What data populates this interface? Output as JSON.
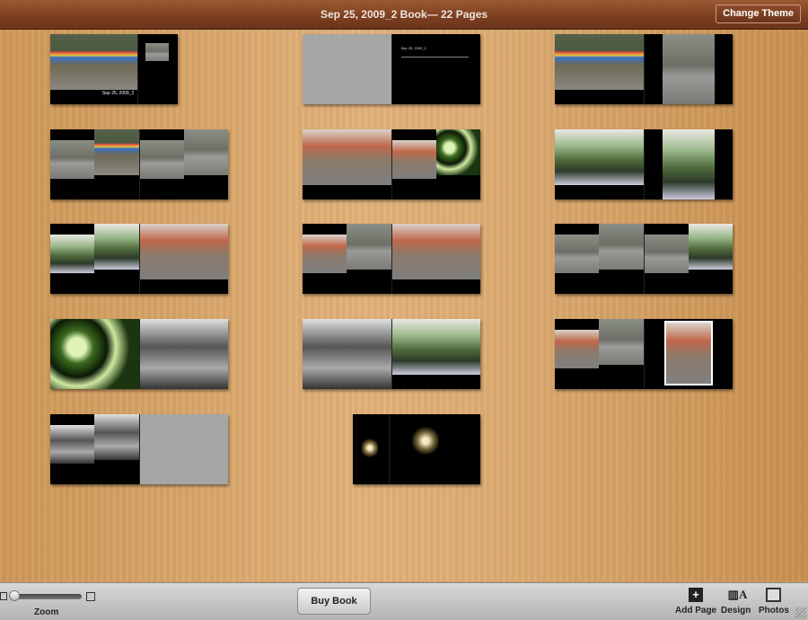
{
  "window": {
    "title": "Sep 25, 2009_2 Book— 22 Pages",
    "change_theme": "Change Theme"
  },
  "cover": {
    "title": "Sep 25, 2009_2"
  },
  "spreads": [
    {
      "row": 0,
      "col": 0,
      "kind": "cover",
      "pages": [
        [
          "market"
        ],
        [
          "black-inset"
        ]
      ]
    },
    {
      "row": 0,
      "col": 1,
      "kind": "spread",
      "pages": [
        [
          "gray"
        ],
        [
          "title-text"
        ]
      ]
    },
    {
      "row": 0,
      "col": 2,
      "kind": "spread",
      "pages": [
        [
          "market"
        ],
        [
          "street-inset"
        ]
      ]
    },
    {
      "row": 1,
      "col": 0,
      "kind": "spread",
      "pages": [
        [
          "street",
          "market"
        ],
        [
          "street",
          "street"
        ]
      ]
    },
    {
      "row": 1,
      "col": 1,
      "kind": "spread",
      "pages": [
        [
          "red"
        ],
        [
          "red",
          "plant"
        ]
      ]
    },
    {
      "row": 1,
      "col": 2,
      "kind": "spread",
      "pages": [
        [
          "shop"
        ],
        [
          "shop-inset"
        ]
      ]
    },
    {
      "row": 2,
      "col": 0,
      "kind": "spread",
      "pages": [
        [
          "shop",
          "shop"
        ],
        [
          "red"
        ]
      ]
    },
    {
      "row": 2,
      "col": 1,
      "kind": "spread",
      "pages": [
        [
          "red",
          "street"
        ],
        [
          "red"
        ]
      ]
    },
    {
      "row": 2,
      "col": 2,
      "kind": "spread",
      "pages": [
        [
          "street",
          "street"
        ],
        [
          "street",
          "shop"
        ]
      ]
    },
    {
      "row": 3,
      "col": 0,
      "kind": "spread",
      "pages": [
        [
          "plant"
        ],
        [
          "bw"
        ]
      ]
    },
    {
      "row": 3,
      "col": 1,
      "kind": "spread",
      "pages": [
        [
          "bw"
        ],
        [
          "shop"
        ]
      ]
    },
    {
      "row": 3,
      "col": 2,
      "kind": "spread",
      "pages": [
        [
          "red",
          "street"
        ],
        [
          "street-portrait"
        ]
      ]
    },
    {
      "row": 4,
      "col": 0,
      "kind": "spread",
      "pages": [
        [
          "bw",
          "bw"
        ],
        [
          "gray"
        ]
      ]
    },
    {
      "row": 4,
      "col": 1,
      "kind": "end",
      "pages": [
        [
          "glow-small"
        ],
        [
          "glow"
        ]
      ]
    }
  ],
  "toolbar": {
    "zoom_label": "Zoom",
    "zoom_level": 0.05,
    "buy_book": "Buy Book",
    "tools": [
      {
        "label": "Add Page",
        "icon": "add-page-icon"
      },
      {
        "label": "Design",
        "icon": "design-icon"
      },
      {
        "label": "Photos",
        "icon": "photos-icon"
      }
    ]
  }
}
